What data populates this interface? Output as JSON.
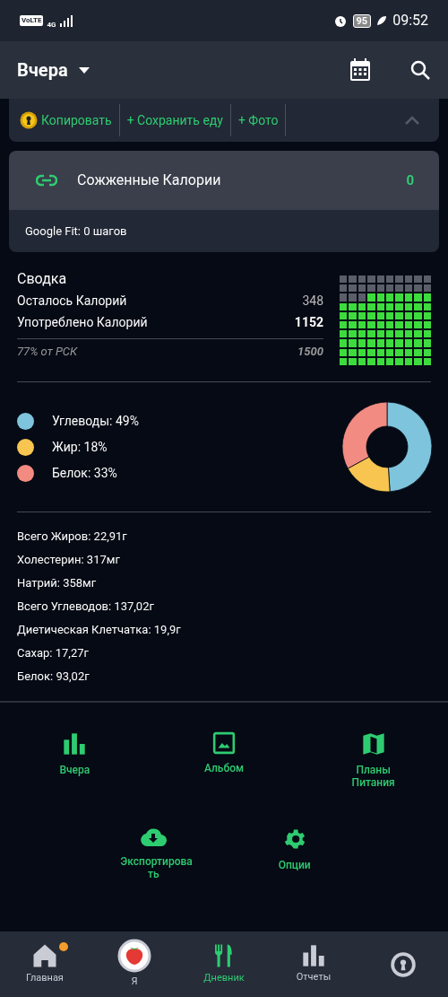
{
  "status_bar": {
    "network": "VoLTE",
    "signal_type": "4G",
    "battery": "95",
    "time": "09:52"
  },
  "app_bar": {
    "title": "Вчера"
  },
  "actions": [
    {
      "kind": "copy",
      "label": "Копировать"
    },
    {
      "kind": "plain",
      "label": "+ Сохранить еду"
    },
    {
      "kind": "plain",
      "label": "+ Фото"
    }
  ],
  "burned": {
    "label": "Сожженные Калории",
    "value": "0",
    "footer": "Google Fit: 0 шагов"
  },
  "summary": {
    "title": "Сводка",
    "rows": [
      {
        "label": "Осталось Калорий",
        "value": "348",
        "bold": false
      },
      {
        "label": "Употреблено Калорий",
        "value": "1152",
        "bold": true
      }
    ],
    "goal_label": "77% от РСК",
    "goal_value": "1500"
  },
  "macros": [
    {
      "label": "Углеводы: 49%",
      "color": "#7ec4dc"
    },
    {
      "label": "Жир: 18%",
      "color": "#f8c550"
    },
    {
      "label": "Белок: 33%",
      "color": "#f28b82"
    }
  ],
  "chart_data": {
    "type": "donut",
    "values": [
      49,
      18,
      33
    ]
  },
  "nutrients": [
    "Всего Жиров: 22,91г",
    "Холестерин: 317мг",
    "Натрий: 358мг",
    "Всего Углеводов: 137,02г",
    "Диетическая Клетчатка: 19,9г",
    "Сахар: 17,27г",
    "Белок: 93,02г"
  ],
  "shortcuts": [
    {
      "kind": "chart",
      "label": "Вчера"
    },
    {
      "kind": "album",
      "label": "Альбом"
    },
    {
      "kind": "map",
      "label": "Планы Питания"
    },
    {
      "kind": "export",
      "label": "Экспортирова ть"
    },
    {
      "kind": "settings",
      "label": "Опции"
    }
  ],
  "nav": [
    {
      "kind": "home",
      "label": "Главная",
      "selected": false,
      "badge": true
    },
    {
      "kind": "me",
      "label": "Я",
      "selected": false,
      "badge": false
    },
    {
      "kind": "diary",
      "label": "Дневник",
      "selected": true,
      "badge": false
    },
    {
      "kind": "reports",
      "label": "Отчеты",
      "selected": false,
      "badge": false
    },
    {
      "kind": "lock",
      "selected": false,
      "badge": false
    }
  ]
}
